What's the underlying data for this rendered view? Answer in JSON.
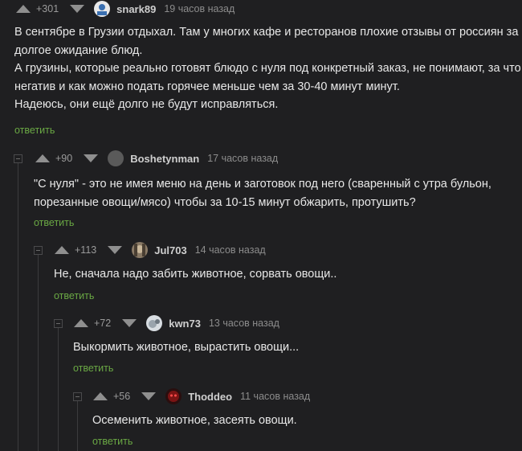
{
  "comments": [
    {
      "rating": "+301",
      "user": "snark89",
      "time": "19 часов назад",
      "avatar": "snark89-avatar",
      "lines": [
        "В сентябре в Грузии отдыхал. Там у многих кафе и ресторанов плохие отзывы от россиян за",
        "долгое ожидание блюд.",
        "А грузины, которые реально готовят блюдо с нуля под конкретный заказ, не понимают, за что",
        "негатив и как можно подать горячее меньше чем за 30-40 минут минут.",
        "Надеюсь, они ещё долго не будут исправляться."
      ],
      "reply": "ответить"
    },
    {
      "rating": "+90",
      "user": "Boshetynman",
      "time": "17 часов назад",
      "avatar": "boshetynman-avatar",
      "lines": [
        "\"С нуля\" - это не имея меню на день и заготовок под него (сваренный с утра бульон,",
        "порезанные овощи/мясо) чтобы за 10-15 минут обжарить, протушить?"
      ],
      "reply": "ответить"
    },
    {
      "rating": "+113",
      "user": "Jul703",
      "time": "14 часов назад",
      "avatar": "jul703-avatar",
      "lines": [
        "Не, сначала надо забить животное, сорвать овощи.."
      ],
      "reply": "ответить"
    },
    {
      "rating": "+72",
      "user": "kwn73",
      "time": "13 часов назад",
      "avatar": "kwn73-avatar",
      "lines": [
        "Выкормить животное, вырастить овощи..."
      ],
      "reply": "ответить"
    },
    {
      "rating": "+56",
      "user": "Thoddeo",
      "time": "11 часов назад",
      "avatar": "thoddeo-avatar",
      "lines": [
        "Осеменить животное, засеять овощи."
      ],
      "reply": "ответить"
    }
  ],
  "colors": {
    "background": "#1f1f21",
    "text": "#e8e8e8",
    "reply_link": "#6aa844",
    "meta": "#8c8c8c"
  }
}
